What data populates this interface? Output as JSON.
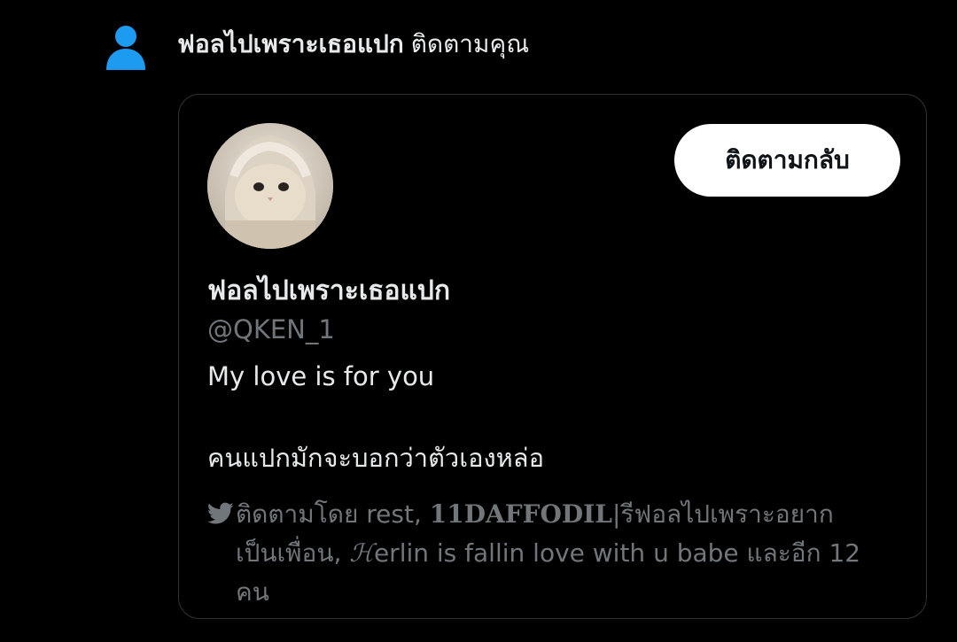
{
  "notification": {
    "icon": "person-icon",
    "name": "ฟอลไปเพราะเธอแปก",
    "action": "ติดตามคุณ"
  },
  "profile": {
    "display_name": "ฟอลไปเพราะเธอแปก",
    "handle": "@QKEN_1",
    "bio_line1": "My love is for you",
    "bio_line2": "คนแปกมักจะบอกว่าตัวเองหล่อ",
    "follow_back_label": "ติดตามกลับ"
  },
  "followed_by": {
    "icon": "twitter-bird-icon",
    "prefix": "ติดตามโดย rest, ",
    "name2": "11DAFFODIL",
    "name2_suffix": "|รีฟอลไปเพราะอยาก",
    "line2_prefix": "เป็นเพื่อน, ",
    "script_h": "ℋ",
    "line2_rest": "erlin is fallin love with u babe และอีก 12",
    "line3": "คน"
  },
  "colors": {
    "background": "#000000",
    "accent_blue": "#1d9bf0",
    "primary_text": "#e7e9ea",
    "secondary_text": "#71767b",
    "border": "#2f3336",
    "button_bg": "#ffffff"
  }
}
